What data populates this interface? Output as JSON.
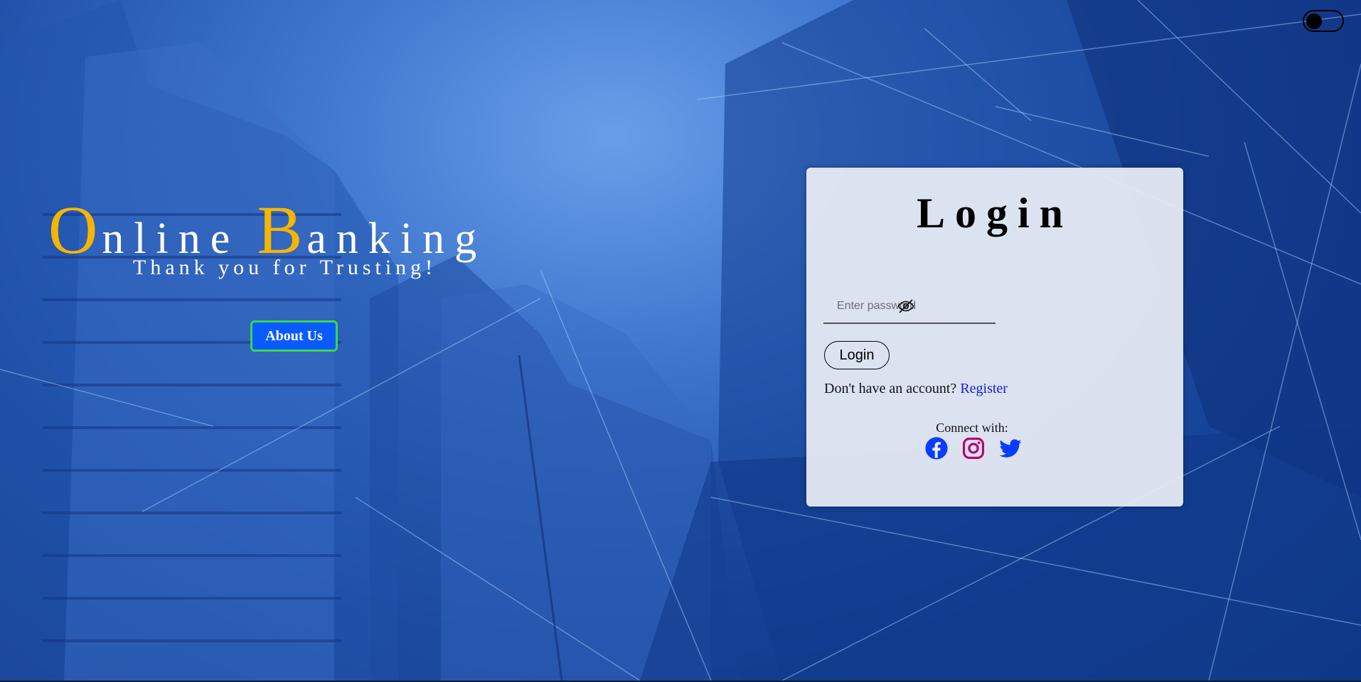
{
  "theme_toggle": {
    "state": "off"
  },
  "brand": {
    "word1_initial": "O",
    "word1_rest": "nline",
    "word2_initial": "B",
    "word2_rest": "anking",
    "tagline": "Thank you for Trusting!"
  },
  "about_button": {
    "label": "About Us"
  },
  "login_card": {
    "title": "Login",
    "password": {
      "placeholder": "Enter password",
      "value": ""
    },
    "login_button": "Login",
    "no_account_text": "Don't have an account?",
    "register_link": "Register",
    "connect_text": "Connect with:",
    "socials": [
      {
        "name": "facebook-icon",
        "color": "#0a3cff"
      },
      {
        "name": "instagram-icon",
        "color": "#b4006e"
      },
      {
        "name": "twitter-icon",
        "color": "#0a3cff"
      }
    ]
  },
  "colors": {
    "accent_gold": "#f7b500",
    "button_blue": "#0a5bff",
    "button_border_green": "#39d84a",
    "link_blue": "#1020d8"
  }
}
